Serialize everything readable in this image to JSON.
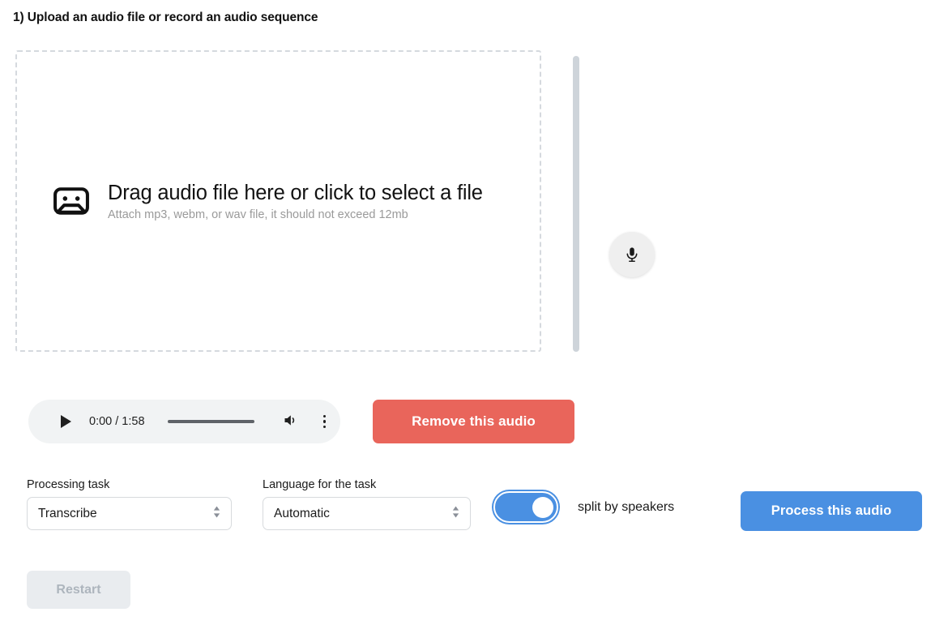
{
  "heading": "1) Upload an audio file or record an audio sequence",
  "dropzone": {
    "icon": "cassette-tape-icon",
    "title": "Drag audio file here or click to select a file",
    "subtitle": "Attach mp3, webm, or wav file, it should not exceed 12mb"
  },
  "record": {
    "icon": "microphone-icon"
  },
  "player": {
    "play_icon": "play-icon",
    "time": "0:00 / 1:58",
    "current_time": "0:00",
    "duration": "1:58",
    "progress_percent": 0,
    "volume_icon": "volume-icon",
    "more_icon": "more-vertical-icon"
  },
  "actions": {
    "remove_label": "Remove this audio",
    "remove_color": "#e9655b",
    "process_label": "Process this audio",
    "process_color": "#4a90e2",
    "restart_label": "Restart"
  },
  "options": {
    "task": {
      "label": "Processing task",
      "value": "Transcribe",
      "options": [
        "Transcribe"
      ]
    },
    "language": {
      "label": "Language for the task",
      "value": "Automatic",
      "options": [
        "Automatic"
      ]
    },
    "split_speakers": {
      "label": "split by speakers",
      "checked": true,
      "accent_color": "#4a90e2"
    }
  }
}
